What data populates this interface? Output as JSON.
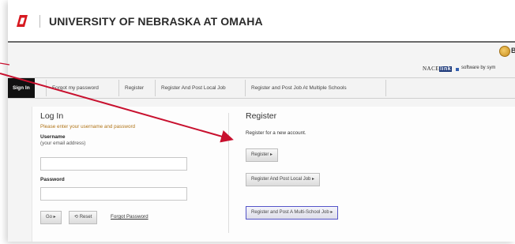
{
  "header": {
    "university_name": "UNIVERSITY OF NEBRASKA AT OMAHA",
    "brand_color": "#d71920"
  },
  "topbar": {
    "cut_text": "B",
    "nace_logo_text": "NACE",
    "nace_logo_link": "link",
    "software_by": "software by sym"
  },
  "nav": {
    "tabs": [
      {
        "label": "Sign In",
        "active": true
      },
      {
        "label": "Forgot my password",
        "active": false
      },
      {
        "label": "Register",
        "active": false
      },
      {
        "label": "Register And Post Local Job",
        "active": false
      },
      {
        "label": "Register and Post Job At Multiple Schools",
        "active": false
      }
    ]
  },
  "login": {
    "title": "Log In",
    "instructions": "Please enter your username and password",
    "username_label": "Username",
    "username_hint": "(your email address)",
    "username_value": "",
    "password_label": "Password",
    "password_value": "",
    "go_button": "Go ▸",
    "reset_button": "⟲ Reset",
    "forgot_link": "Forgot Password"
  },
  "register": {
    "title": "Register",
    "subtitle": "Register for a new account.",
    "register_button": "Register ▸",
    "register_local_button": "Register And Post Local Job ▸",
    "register_multi_button": "Register and Post A Multi-School Job ▸"
  },
  "colors": {
    "annotation_arrow": "#c8102e",
    "nav_active": "#111111",
    "hint_text": "#b07418"
  },
  "icons": {
    "logo": "omaha-o-logo",
    "topbar": "circle-icon"
  }
}
